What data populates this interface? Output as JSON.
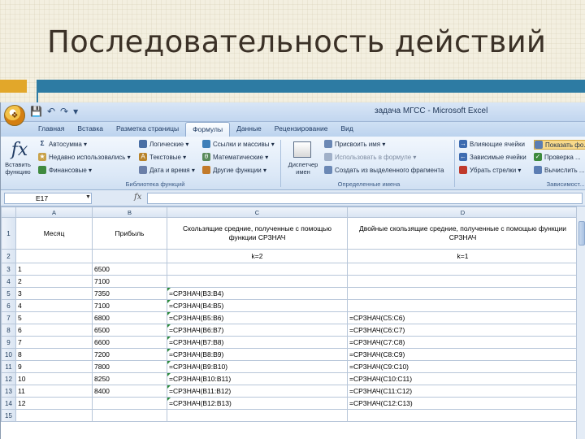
{
  "slide": {
    "title": "Последовательность действий"
  },
  "window": {
    "title": "задача МГСС - Microsoft Excel"
  },
  "ribbon": {
    "tabs": [
      "Главная",
      "Вставка",
      "Разметка страницы",
      "Формулы",
      "Данные",
      "Рецензирование",
      "Вид"
    ],
    "active_tab": "Формулы",
    "insert_function_label": "Вставить функцию",
    "library_items": {
      "autosum": "Автосумма ▾",
      "recent": "Недавно использовались ▾",
      "financial": "Финансовые ▾",
      "logical": "Логические ▾",
      "text": "Текстовые ▾",
      "datetime": "Дата и время ▾",
      "lookup": "Ссылки и массивы ▾",
      "math": "Математические ▾",
      "other": "Другие функции ▾"
    },
    "library_group_label": "Библиотека функций",
    "name_manager_label": "Диспетчер имен",
    "names_items": {
      "assign": "Присвоить имя ▾",
      "use": "Использовать в формуле ▾",
      "create": "Создать из выделенного фрагмента"
    },
    "names_group_label": "Определенные имена",
    "audit_items": {
      "precedents": "Влияющие ячейки",
      "dependents": "Зависимые ячейки",
      "remove": "Убрать стрелки ▾",
      "show": "Показать фо...",
      "check": "Проверка ...",
      "evaluate": "Вычислить ..."
    },
    "audit_group_label": "Зависимост..."
  },
  "formula_bar": {
    "cell_ref": "E17",
    "fx": "fx",
    "value": ""
  },
  "sheet": {
    "columns": [
      "A",
      "B",
      "C",
      "D"
    ],
    "header_row": {
      "a": "Месяц",
      "b": "Прибыль",
      "c": "Скользящие средние, полученные с помощью функции СРЗНАЧ",
      "d": "Двойные скользящие средние, полученные с помощью функции СРЗНАЧ"
    },
    "k_row": {
      "c": "k=2",
      "d": "k=1"
    },
    "rows": [
      {
        "n": "3",
        "a": "1",
        "b": "6500",
        "c": "",
        "d": ""
      },
      {
        "n": "4",
        "a": "2",
        "b": "7100",
        "c": "",
        "d": ""
      },
      {
        "n": "5",
        "a": "3",
        "b": "7350",
        "c": "=СРЗНАЧ(B3:B4)",
        "d": ""
      },
      {
        "n": "6",
        "a": "4",
        "b": "7100",
        "c": "=СРЗНАЧ(B4:B5)",
        "d": ""
      },
      {
        "n": "7",
        "a": "5",
        "b": "6800",
        "c": "=СРЗНАЧ(B5:B6)",
        "d": "=СРЗНАЧ(C5:C6)"
      },
      {
        "n": "8",
        "a": "6",
        "b": "6500",
        "c": "=СРЗНАЧ(B6:B7)",
        "d": "=СРЗНАЧ(C6:C7)"
      },
      {
        "n": "9",
        "a": "7",
        "b": "6600",
        "c": "=СРЗНАЧ(B7:B8)",
        "d": "=СРЗНАЧ(C7:C8)"
      },
      {
        "n": "10",
        "a": "8",
        "b": "7200",
        "c": "=СРЗНАЧ(B8:B9)",
        "d": "=СРЗНАЧ(C8:C9)"
      },
      {
        "n": "11",
        "a": "9",
        "b": "7800",
        "c": "=СРЗНАЧ(B9:B10)",
        "d": "=СРЗНАЧ(C9:C10)"
      },
      {
        "n": "12",
        "a": "10",
        "b": "8250",
        "c": "=СРЗНАЧ(B10:B11)",
        "d": "=СРЗНАЧ(C10:C11)"
      },
      {
        "n": "13",
        "a": "11",
        "b": "8400",
        "c": "=СРЗНАЧ(B11:B12)",
        "d": "=СРЗНАЧ(C11:C12)"
      },
      {
        "n": "14",
        "a": "12",
        "b": "",
        "c": "=СРЗНАЧ(B12:B13)",
        "d": "=СРЗНАЧ(C12:C13)"
      },
      {
        "n": "15",
        "a": "",
        "b": "",
        "c": "",
        "d": ""
      }
    ]
  },
  "colors": {
    "accent_blue": "#2d7ba3",
    "accent_orange": "#e2a72a"
  }
}
